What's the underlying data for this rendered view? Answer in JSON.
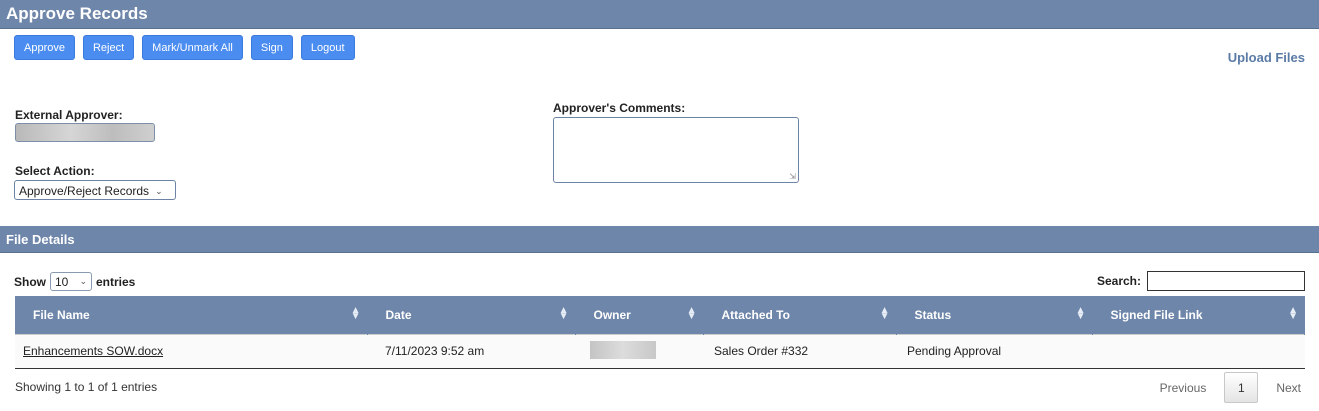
{
  "header": {
    "title": "Approve Records"
  },
  "toolbar": {
    "approve_label": "Approve",
    "reject_label": "Reject",
    "mark_all_label": "Mark/Unmark All",
    "sign_label": "Sign",
    "logout_label": "Logout"
  },
  "upload_files_label": "Upload Files",
  "form": {
    "external_approver_label": "External Approver:",
    "select_action_label": "Select Action:",
    "select_action_value": "Approve/Reject Records",
    "comments_label": "Approver's Comments:"
  },
  "file_details": {
    "title": "File Details",
    "show_label": "Show",
    "page_length": "10",
    "entries_label": "entries",
    "search_label": "Search:",
    "columns": [
      "File Name",
      "Date",
      "Owner",
      "Attached To",
      "Status",
      "Signed File Link"
    ],
    "rows": [
      {
        "file_name": "Enhancements SOW.docx",
        "date": "7/11/2023 9:52 am",
        "attached_to": "Sales Order #332",
        "status": "Pending Approval",
        "signed_file_link": ""
      }
    ],
    "info": "Showing 1 to 1 of 1 entries",
    "pagination": {
      "previous": "Previous",
      "current": "1",
      "next": "Next"
    }
  },
  "colors": {
    "header_band": "#6e86a9",
    "button": "#4a8cf0",
    "link": "#5a7ba6"
  }
}
